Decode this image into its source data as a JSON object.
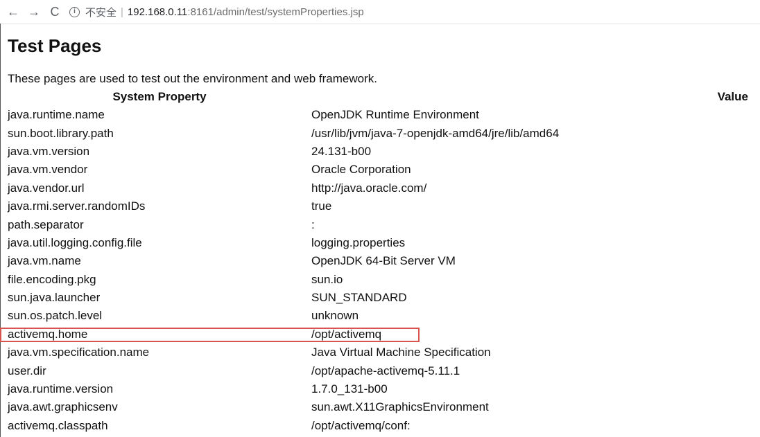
{
  "browser": {
    "back_glyph": "←",
    "forward_glyph": "→",
    "reload_glyph": "C",
    "info_glyph": "i",
    "security_label": "不安全",
    "separator": "|",
    "url_host": "192.168.0.11",
    "url_rest": ":8161/admin/test/systemProperties.jsp"
  },
  "page": {
    "title": "Test Pages",
    "intro": "These pages are used to test out the environment and web framework."
  },
  "table": {
    "headers": {
      "property": "System Property",
      "value": "Value"
    },
    "rows": [
      {
        "property": "java.runtime.name",
        "value": "OpenJDK Runtime Environment"
      },
      {
        "property": "sun.boot.library.path",
        "value": "/usr/lib/jvm/java-7-openjdk-amd64/jre/lib/amd64"
      },
      {
        "property": "java.vm.version",
        "value": "24.131-b00"
      },
      {
        "property": "java.vm.vendor",
        "value": "Oracle Corporation"
      },
      {
        "property": "java.vendor.url",
        "value": "http://java.oracle.com/"
      },
      {
        "property": "java.rmi.server.randomIDs",
        "value": "true"
      },
      {
        "property": "path.separator",
        "value": ":"
      },
      {
        "property": "java.util.logging.config.file",
        "value": "logging.properties"
      },
      {
        "property": "java.vm.name",
        "value": "OpenJDK 64-Bit Server VM"
      },
      {
        "property": "file.encoding.pkg",
        "value": "sun.io"
      },
      {
        "property": "sun.java.launcher",
        "value": "SUN_STANDARD"
      },
      {
        "property": "sun.os.patch.level",
        "value": "unknown"
      },
      {
        "property": "activemq.home",
        "value": "/opt/activemq"
      },
      {
        "property": "java.vm.specification.name",
        "value": "Java Virtual Machine Specification"
      },
      {
        "property": "user.dir",
        "value": "/opt/apache-activemq-5.11.1"
      },
      {
        "property": "java.runtime.version",
        "value": "1.7.0_131-b00"
      },
      {
        "property": "java.awt.graphicsenv",
        "value": "sun.awt.X11GraphicsEnvironment"
      },
      {
        "property": "activemq.classpath",
        "value": "/opt/activemq/conf:"
      }
    ]
  },
  "colors": {
    "highlight_border": "#d9534f"
  }
}
